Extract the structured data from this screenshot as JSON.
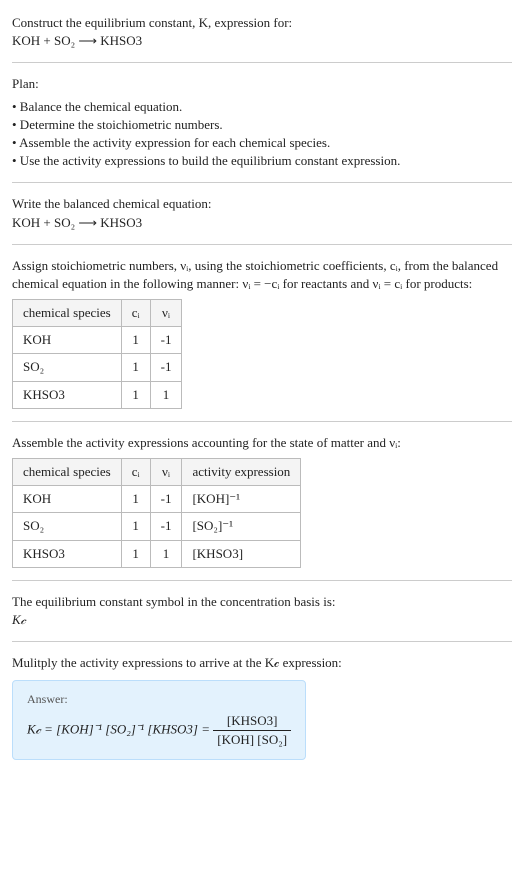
{
  "header": {
    "construct_line": "Construct the equilibrium constant, K, expression for:",
    "equation_unbalanced": "KOH + SO₂ ⟶ KHSO3"
  },
  "plan": {
    "title": "Plan:",
    "items": [
      "• Balance the chemical equation.",
      "• Determine the stoichiometric numbers.",
      "• Assemble the activity expression for each chemical species.",
      "• Use the activity expressions to build the equilibrium constant expression."
    ]
  },
  "balanced": {
    "intro": "Write the balanced chemical equation:",
    "equation": "KOH + SO₂ ⟶ KHSO3"
  },
  "assign": {
    "text": "Assign stoichiometric numbers, νᵢ, using the stoichiometric coefficients, cᵢ, from the balanced chemical equation in the following manner: νᵢ = −cᵢ for reactants and νᵢ = cᵢ for products:"
  },
  "table1": {
    "headers": [
      "chemical species",
      "cᵢ",
      "νᵢ"
    ],
    "rows": [
      {
        "species": "KOH",
        "c": "1",
        "v": "-1"
      },
      {
        "species": "SO₂",
        "c": "1",
        "v": "-1"
      },
      {
        "species": "KHSO3",
        "c": "1",
        "v": "1"
      }
    ]
  },
  "assemble": {
    "text": "Assemble the activity expressions accounting for the state of matter and νᵢ:"
  },
  "table2": {
    "headers": [
      "chemical species",
      "cᵢ",
      "νᵢ",
      "activity expression"
    ],
    "rows": [
      {
        "species": "KOH",
        "c": "1",
        "v": "-1",
        "act": "[KOH]⁻¹"
      },
      {
        "species": "SO₂",
        "c": "1",
        "v": "-1",
        "act": "[SO₂]⁻¹"
      },
      {
        "species": "KHSO3",
        "c": "1",
        "v": "1",
        "act": "[KHSO3]"
      }
    ]
  },
  "symbol": {
    "line1": "The equilibrium constant symbol in the concentration basis is:",
    "line2": "K𝒸"
  },
  "multiply": {
    "text": "Mulitply the activity expressions to arrive at the K𝒸 expression:"
  },
  "answer": {
    "label": "Answer:",
    "lhs": "K𝒸 = [KOH]⁻¹ [SO₂]⁻¹ [KHSO3] = ",
    "num": "[KHSO3]",
    "den": "[KOH] [SO₂]"
  },
  "chart_data": {
    "type": "table",
    "tables": [
      {
        "title": "stoichiometric numbers",
        "columns": [
          "chemical species",
          "c_i",
          "v_i"
        ],
        "rows": [
          [
            "KOH",
            1,
            -1
          ],
          [
            "SO2",
            1,
            -1
          ],
          [
            "KHSO3",
            1,
            1
          ]
        ]
      },
      {
        "title": "activity expressions",
        "columns": [
          "chemical species",
          "c_i",
          "v_i",
          "activity expression"
        ],
        "rows": [
          [
            "KOH",
            1,
            -1,
            "[KOH]^-1"
          ],
          [
            "SO2",
            1,
            -1,
            "[SO2]^-1"
          ],
          [
            "KHSO3",
            1,
            1,
            "[KHSO3]"
          ]
        ]
      }
    ]
  }
}
